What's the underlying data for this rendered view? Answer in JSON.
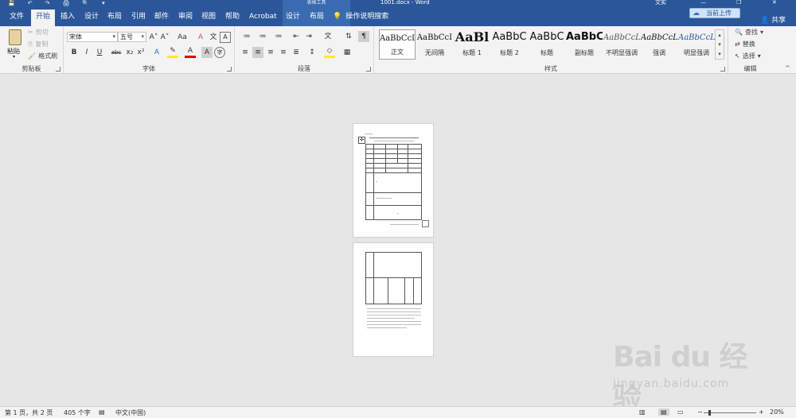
{
  "titlebar": {
    "quick_access": [
      "💾",
      "↶",
      "↷",
      "🖨",
      "🔍",
      "▾"
    ],
    "context_tab": "表格工具",
    "doc_title": "1001.docx - Word",
    "user": "文实",
    "minimize": "—",
    "maximize": "❐",
    "close": "✕"
  },
  "tabs": [
    "文件",
    "开始",
    "插入",
    "设计",
    "布局",
    "引用",
    "邮件",
    "审阅",
    "视图",
    "帮助",
    "Acrobat",
    "设计",
    "布局"
  ],
  "tell_me": "操作说明搜索",
  "upload": "当前上传",
  "share": "共享",
  "clipboard": {
    "paste": "粘贴",
    "cut": "剪切",
    "copy": "复制",
    "format_painter": "格式刷",
    "label": "剪贴板"
  },
  "font": {
    "name": "宋体",
    "size": "五号",
    "grow": "A˄",
    "shrink": "A˅",
    "case": "Aa",
    "clear": "A",
    "phonetic": "文",
    "char_border": "A",
    "bold": "B",
    "italic": "I",
    "underline": "U",
    "strike": "abc",
    "subscript": "x₂",
    "superscript": "x²",
    "effects": "A",
    "highlight": "✎",
    "color": "A",
    "shading": "A",
    "enclose": "字",
    "label": "字体"
  },
  "paragraph": {
    "label": "段落",
    "icons": [
      "≔",
      "≔",
      "≔",
      "⇤",
      "⇥",
      "文",
      "⇅",
      "¶"
    ],
    "icons2": [
      "≡",
      "≡",
      "≡",
      "≡",
      "≣",
      "↕",
      "◇",
      "▦"
    ]
  },
  "styles": {
    "label": "样式",
    "items": [
      {
        "sample": "AaBbCcI",
        "name": "正文"
      },
      {
        "sample": "AaBbCcI",
        "name": "无间隔"
      },
      {
        "sample": "AaBl",
        "name": "标题 1"
      },
      {
        "sample": "AaBbC",
        "name": "标题 2"
      },
      {
        "sample": "AaBbC",
        "name": "标题"
      },
      {
        "sample": "AaBbC",
        "name": "副标题"
      },
      {
        "sample": "AaBbCcL",
        "name": "不明显强调"
      },
      {
        "sample": "AaBbCcL",
        "name": "强调"
      },
      {
        "sample": "AaBbCcL",
        "name": "明显强调"
      }
    ]
  },
  "editing": {
    "find": "查找",
    "replace": "替换",
    "select": "选择",
    "label": "编辑"
  },
  "status": {
    "page": "第 1 页，共 2 页",
    "words": "405 个字",
    "language": "中文(中国)",
    "zoom": "20%",
    "zoom_out": "−",
    "zoom_in": "+"
  },
  "watermark": {
    "logo": "Bai du 经验",
    "url": "jingyan.baidu.com"
  }
}
